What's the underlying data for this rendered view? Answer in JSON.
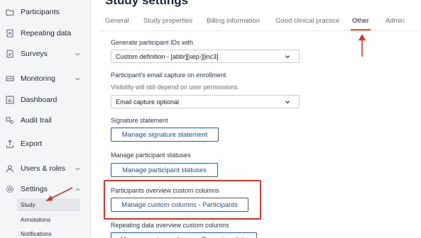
{
  "sidebar": {
    "items": [
      {
        "label": "Participants",
        "icon": "folder-icon",
        "has_chevron": false
      },
      {
        "label": "Repeating data",
        "icon": "document-icon",
        "has_chevron": false
      },
      {
        "label": "Surveys",
        "icon": "survey-icon",
        "has_chevron": true
      },
      {
        "label": "Monitoring",
        "icon": "monitor-icon",
        "has_chevron": true
      },
      {
        "label": "Dashboard",
        "icon": "chart-icon",
        "has_chevron": false
      },
      {
        "label": "Audit trail",
        "icon": "audit-icon",
        "has_chevron": false
      },
      {
        "label": "Export",
        "icon": "export-icon",
        "has_chevron": false
      },
      {
        "label": "Users & roles",
        "icon": "user-icon",
        "has_chevron": true
      },
      {
        "label": "Settings",
        "icon": "gear-icon",
        "has_chevron": true,
        "expanded": true
      }
    ],
    "settings_sub": [
      {
        "label": "Study",
        "active": true
      },
      {
        "label": "Annotations",
        "active": false
      },
      {
        "label": "Notifications",
        "active": false
      }
    ]
  },
  "main": {
    "title": "Study settings",
    "tabs": [
      {
        "label": "General",
        "active": false
      },
      {
        "label": "Study properties",
        "active": false
      },
      {
        "label": "Billing information",
        "active": false
      },
      {
        "label": "Good clinical practice",
        "active": false
      },
      {
        "label": "Other",
        "active": true
      },
      {
        "label": "Admin",
        "active": false
      }
    ],
    "participant_ids": {
      "label": "Generate participant IDs with",
      "value": "Custom definition - [abbr][sep-][inc3]"
    },
    "email_capture": {
      "label": "Participant's email capture on enrollment",
      "hint": "Visibility will still depend on user permissions.",
      "value": "Email capture optional"
    },
    "signature": {
      "label": "Signature statement",
      "button": "Manage signature statement"
    },
    "statuses": {
      "label": "Manage participant statuses",
      "button": "Manage participant statuses"
    },
    "overview_columns": {
      "label": "Participants overview custom columns",
      "button": "Manage custom columns - Participants"
    },
    "repeating_columns": {
      "label": "Repeating data overview custom columns",
      "button": "Manage custom columns - Repeating data"
    }
  },
  "colors": {
    "accent": "#e7542d",
    "annotation": "#e0302c",
    "button_border": "#2f5fb8"
  }
}
